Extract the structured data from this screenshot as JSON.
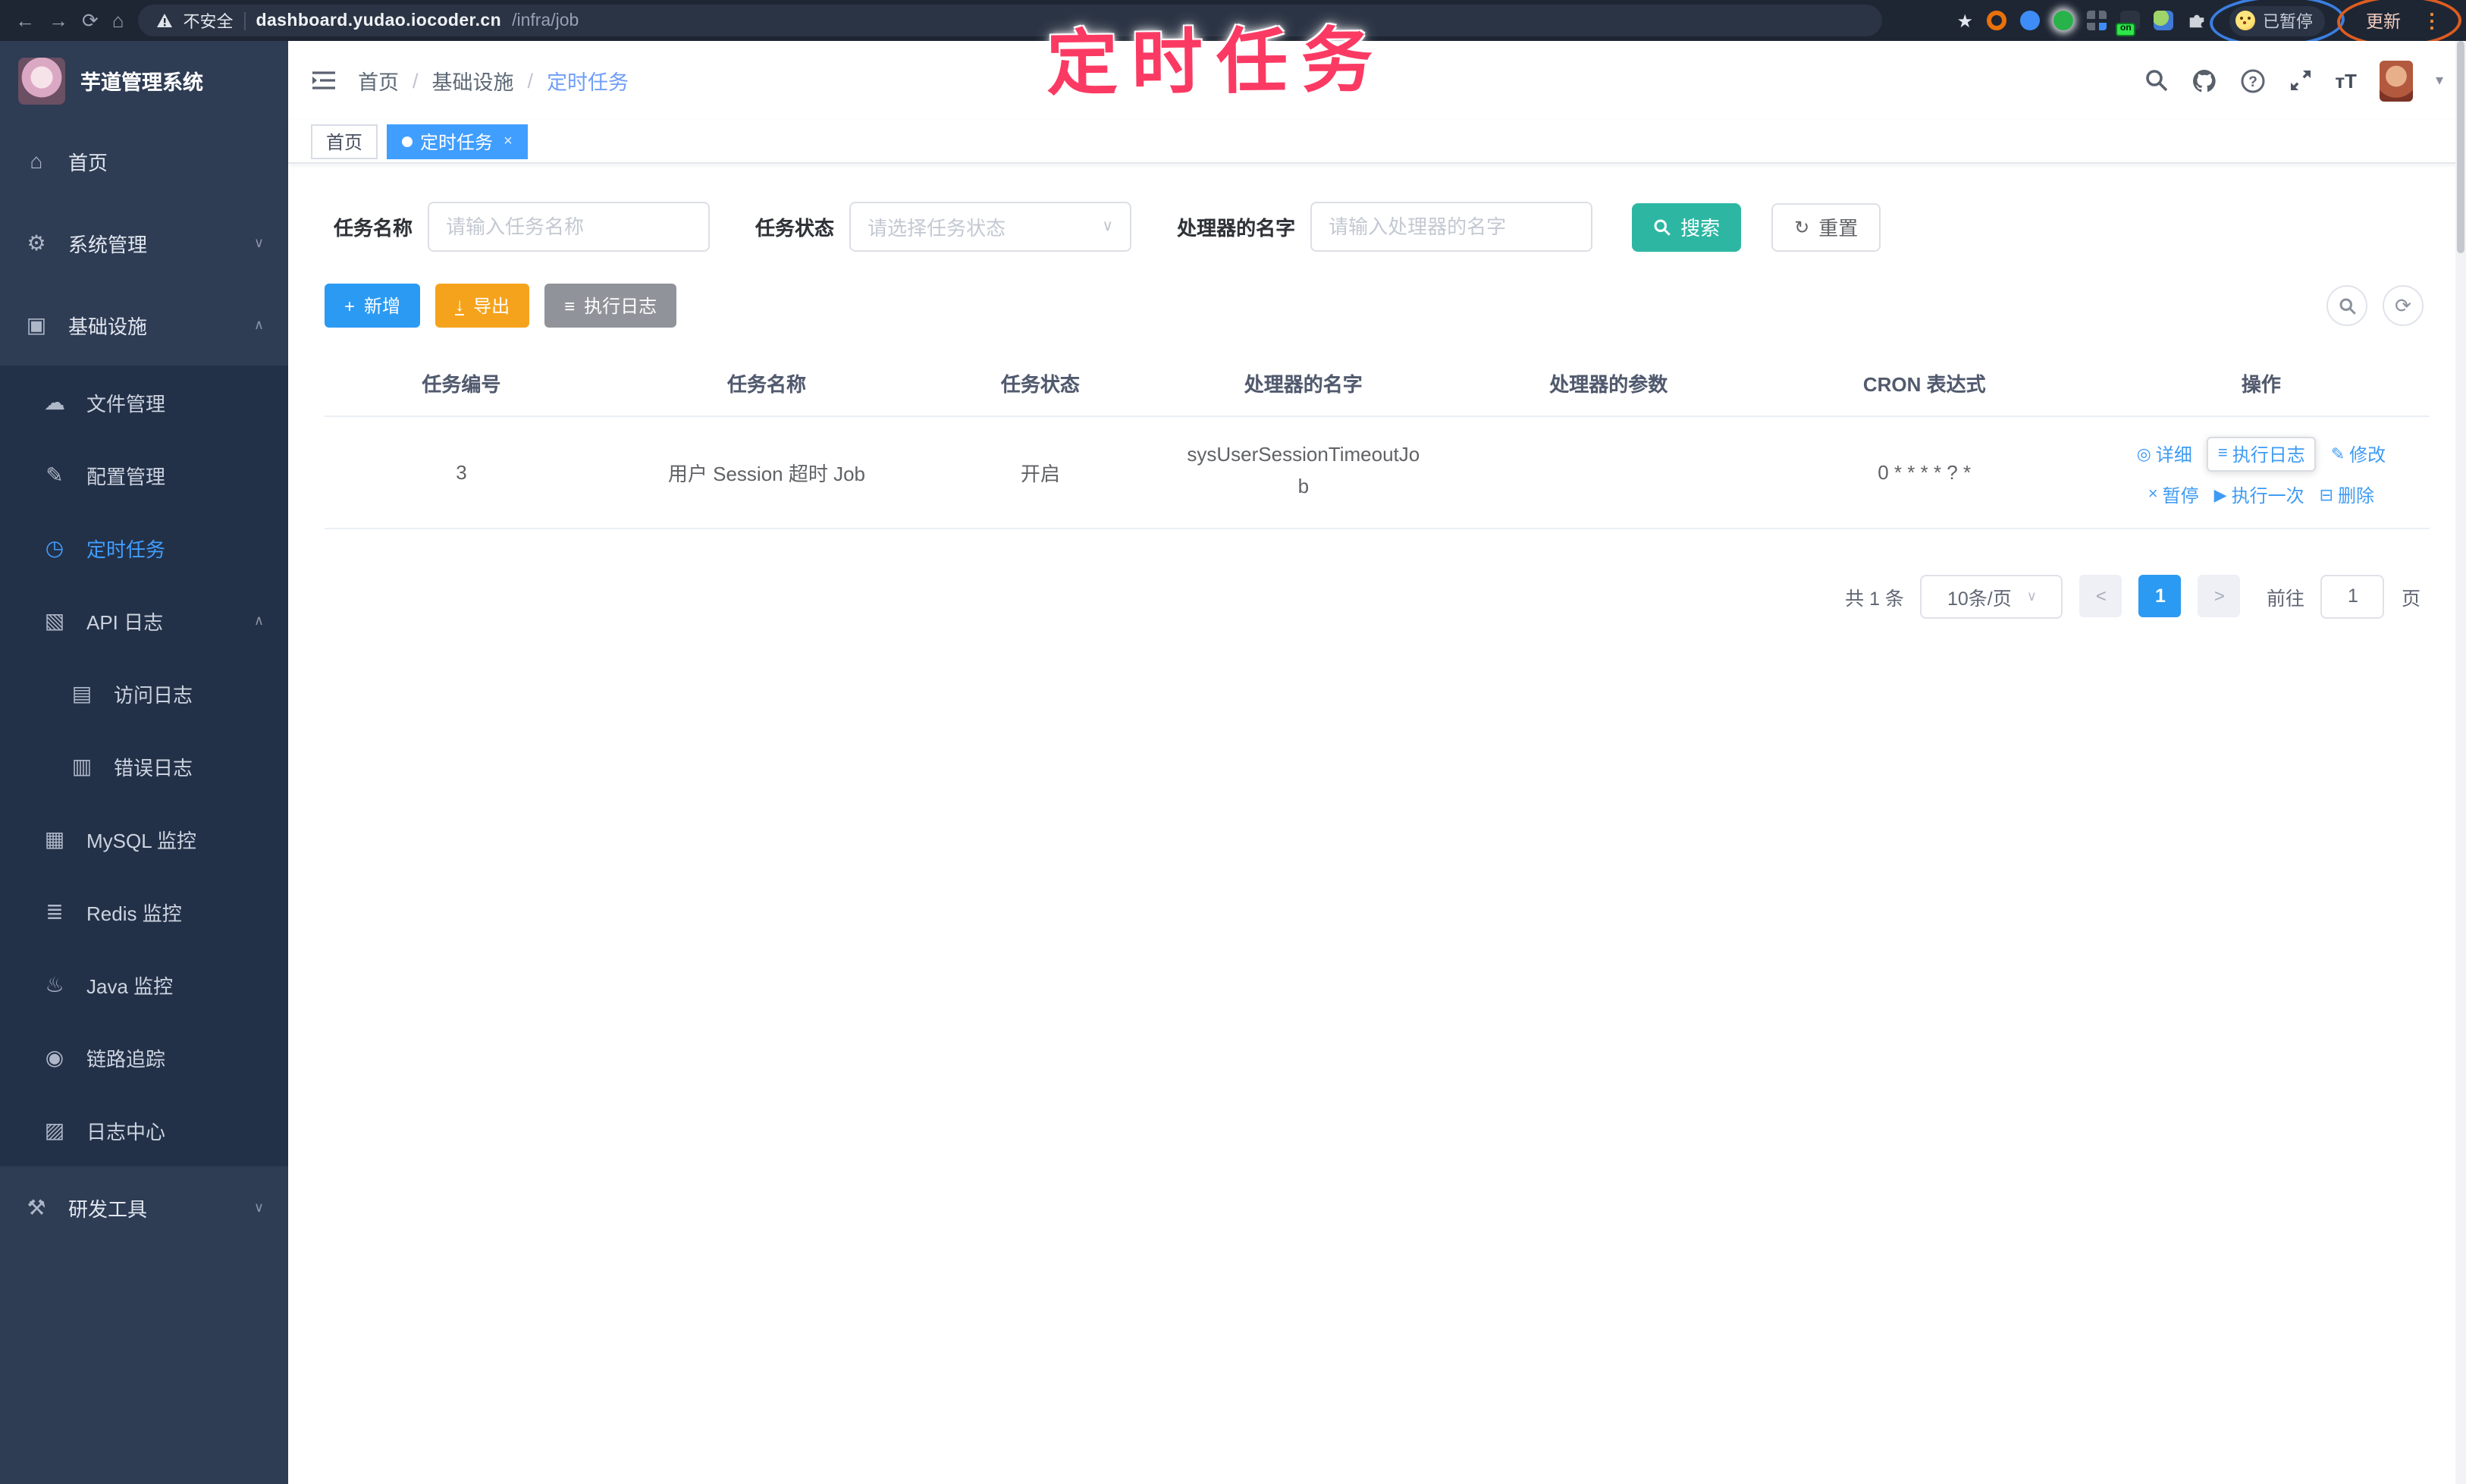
{
  "browser": {
    "security_label": "不安全",
    "url_host": "dashboard.yudao.iocoder.cn",
    "url_path": "/infra/job",
    "extension_badge": "on",
    "paused_label": "已暂停",
    "update_label": "更新"
  },
  "annotation": {
    "text": "定时任务",
    "color": "#fb3a63"
  },
  "sidebar": {
    "title": "芋道管理系统",
    "items": [
      {
        "label": "首页",
        "icon": "home-icon"
      },
      {
        "label": "系统管理",
        "icon": "gear-icon"
      },
      {
        "label": "基础设施",
        "icon": "infra-icon"
      },
      {
        "label": "文件管理",
        "icon": "file-manage-icon"
      },
      {
        "label": "配置管理",
        "icon": "config-manage-icon"
      },
      {
        "label": "定时任务",
        "icon": "timer-icon"
      },
      {
        "label": "API 日志",
        "icon": "api-log-icon"
      },
      {
        "label": "访问日志",
        "icon": "access-log-icon"
      },
      {
        "label": "错误日志",
        "icon": "error-log-icon"
      },
      {
        "label": "MySQL 监控",
        "icon": "mysql-icon"
      },
      {
        "label": "Redis 监控",
        "icon": "redis-icon"
      },
      {
        "label": "Java 监控",
        "icon": "java-icon"
      },
      {
        "label": "链路追踪",
        "icon": "trace-icon"
      },
      {
        "label": "日志中心",
        "icon": "log-center-icon"
      },
      {
        "label": "研发工具",
        "icon": "devtools-icon"
      }
    ]
  },
  "header": {
    "breadcrumb": [
      "首页",
      "基础设施",
      "定时任务"
    ],
    "separator": "/"
  },
  "tabs": [
    {
      "label": "首页"
    },
    {
      "label": "定时任务"
    }
  ],
  "filters": {
    "name_label": "任务名称",
    "name_placeholder": "请输入任务名称",
    "status_label": "任务状态",
    "status_placeholder": "请选择任务状态",
    "handler_label": "处理器的名字",
    "handler_placeholder": "请输入处理器的名字",
    "search_label": "搜索",
    "reset_label": "重置"
  },
  "toolbar": {
    "add_label": "新增",
    "export_label": "导出",
    "exec_log_label": "执行日志"
  },
  "table": {
    "columns": [
      "任务编号",
      "任务名称",
      "任务状态",
      "处理器的名字",
      "处理器的参数",
      "CRON 表达式",
      "操作"
    ],
    "row": {
      "id": "3",
      "name": "用户 Session 超时 Job",
      "status": "开启",
      "handler": "sysUserSessionTimeoutJob",
      "param": "",
      "cron": "0 * * * * ? *"
    },
    "actions": {
      "detail": "详细",
      "exec_log": "执行日志",
      "edit": "修改",
      "pause": "暂停",
      "run_once": "执行一次",
      "delete": "删除"
    }
  },
  "pagination": {
    "total": "共 1 条",
    "page_size": "10条/页",
    "prev": "<",
    "current": "1",
    "next": ">",
    "goto_prefix": "前往",
    "goto_value": "1",
    "goto_suffix": "页"
  },
  "colors": {
    "accent": "#409eff",
    "search_button": "#2db7a3",
    "export_button": "#f5a31c",
    "info_button": "#909399",
    "sidebar_bg": "#2e3c54",
    "submenu_bg": "#233148",
    "annotation_pink": "#fb3a63"
  }
}
